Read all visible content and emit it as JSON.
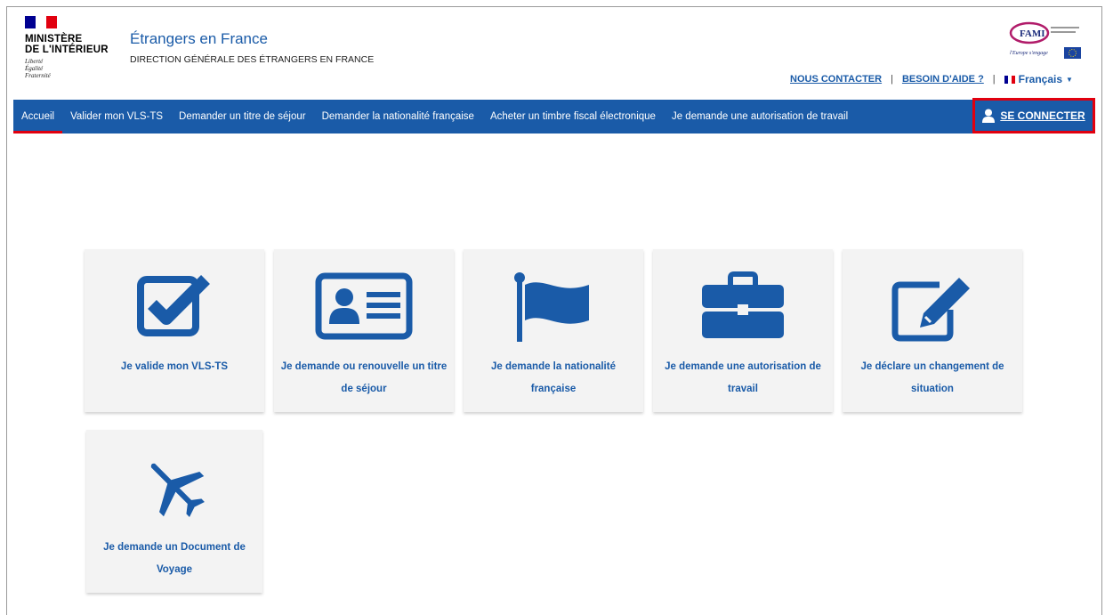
{
  "header": {
    "ministry_lines": [
      "MINISTÈRE",
      "DE L'INTÉRIEUR"
    ],
    "motto_lines": [
      "Liberté",
      "Égalité",
      "Fraternité"
    ],
    "site_title": "Étrangers en France",
    "site_subtitle": "DIRECTION GÉNÉRALE DES ÉTRANGERS EN FRANCE",
    "fami_logo_text": "FAMI",
    "fami_tagline": "l'Europe s'engage",
    "links": {
      "contact": "NOUS CONTACTER",
      "help": "BESOIN D'AIDE ?",
      "language": "Français"
    }
  },
  "nav": {
    "items": [
      "Accueil",
      "Valider mon VLS-TS",
      "Demander un titre de séjour",
      "Demander la nationalité française",
      "Acheter un timbre fiscal électronique",
      "Je demande une autorisation de travail"
    ],
    "active_index": 0,
    "login": "SE CONNECTER"
  },
  "tiles": [
    {
      "label": "Je valide mon VLS-TS",
      "icon": "checkbox-check-icon"
    },
    {
      "label": "Je demande ou renouvelle un titre de séjour",
      "icon": "id-card-icon"
    },
    {
      "label": "Je demande la nationalité française",
      "icon": "flag-icon"
    },
    {
      "label": "Je demande une autorisation de travail",
      "icon": "briefcase-icon"
    },
    {
      "label": "Je déclare un changement de situation",
      "icon": "edit-icon"
    },
    {
      "label": "Je demande un Document de Voyage",
      "icon": "plane-icon"
    }
  ],
  "colors": {
    "brand_blue": "#1a5ba8",
    "highlight_red": "#e1000f",
    "tile_bg": "#f3f3f3"
  }
}
